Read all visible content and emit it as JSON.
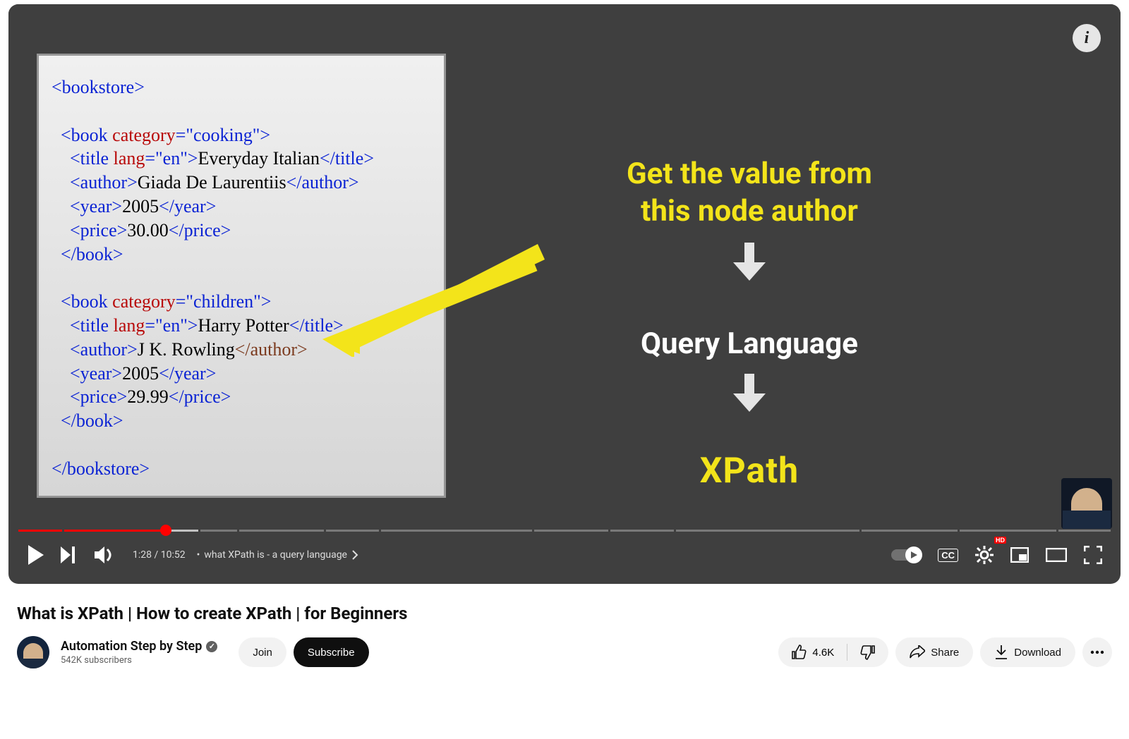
{
  "video": {
    "title": "What is XPath | How to create XPath | for Beginners",
    "current_time": "1:28",
    "duration": "10:52",
    "chapter_label": "what XPath is - a query language",
    "separator": " / ",
    "chapter_prefix": " • ",
    "progress_percent": 13.5,
    "buffered_percent": 16.5,
    "chapter_marks_percent": [
      4,
      16.5,
      20,
      28,
      33,
      47,
      54,
      60,
      77,
      86,
      95
    ]
  },
  "slide": {
    "code_lines": [
      [
        {
          "cls": "t-blue",
          "t": "<bookstore>"
        }
      ],
      [
        {
          "cls": "",
          "t": ""
        }
      ],
      [
        {
          "cls": "",
          "t": "  "
        },
        {
          "cls": "t-blue",
          "t": "<book "
        },
        {
          "cls": "t-red",
          "t": "category"
        },
        {
          "cls": "t-blue",
          "t": "="
        },
        {
          "cls": "t-blue",
          "t": "\"cooking\">"
        }
      ],
      [
        {
          "cls": "",
          "t": "    "
        },
        {
          "cls": "t-blue",
          "t": "<title "
        },
        {
          "cls": "t-red",
          "t": "lang"
        },
        {
          "cls": "t-blue",
          "t": "=\"en\">"
        },
        {
          "cls": "t-black",
          "t": "Everyday Italian"
        },
        {
          "cls": "t-blue",
          "t": "</title>"
        }
      ],
      [
        {
          "cls": "",
          "t": "    "
        },
        {
          "cls": "t-blue",
          "t": "<author>"
        },
        {
          "cls": "t-black",
          "t": "Giada De Laurentiis"
        },
        {
          "cls": "t-blue",
          "t": "</author>"
        }
      ],
      [
        {
          "cls": "",
          "t": "    "
        },
        {
          "cls": "t-blue",
          "t": "<year>"
        },
        {
          "cls": "t-black",
          "t": "2005"
        },
        {
          "cls": "t-blue",
          "t": "</year>"
        }
      ],
      [
        {
          "cls": "",
          "t": "    "
        },
        {
          "cls": "t-blue",
          "t": "<price>"
        },
        {
          "cls": "t-black",
          "t": "30.00"
        },
        {
          "cls": "t-blue",
          "t": "</price>"
        }
      ],
      [
        {
          "cls": "",
          "t": "  "
        },
        {
          "cls": "t-blue",
          "t": "</book>"
        }
      ],
      [
        {
          "cls": "",
          "t": ""
        }
      ],
      [
        {
          "cls": "",
          "t": "  "
        },
        {
          "cls": "t-blue",
          "t": "<book "
        },
        {
          "cls": "t-red",
          "t": "category"
        },
        {
          "cls": "t-blue",
          "t": "=\"children\">"
        }
      ],
      [
        {
          "cls": "",
          "t": "    "
        },
        {
          "cls": "t-blue",
          "t": "<title "
        },
        {
          "cls": "t-red",
          "t": "lang"
        },
        {
          "cls": "t-blue",
          "t": "=\"en\">"
        },
        {
          "cls": "t-black",
          "t": "Harry Potter"
        },
        {
          "cls": "t-blue",
          "t": "</title>"
        }
      ],
      [
        {
          "cls": "",
          "t": "    "
        },
        {
          "cls": "t-blue",
          "t": "<author>"
        },
        {
          "cls": "t-black",
          "t": "J K. Rowling"
        },
        {
          "cls": "t-brown",
          "t": "</author>"
        }
      ],
      [
        {
          "cls": "",
          "t": "    "
        },
        {
          "cls": "t-blue",
          "t": "<year>"
        },
        {
          "cls": "t-black",
          "t": "2005"
        },
        {
          "cls": "t-blue",
          "t": "</year>"
        }
      ],
      [
        {
          "cls": "",
          "t": "    "
        },
        {
          "cls": "t-blue",
          "t": "<price>"
        },
        {
          "cls": "t-black",
          "t": "29.99"
        },
        {
          "cls": "t-blue",
          "t": "</price>"
        }
      ],
      [
        {
          "cls": "",
          "t": "  "
        },
        {
          "cls": "t-blue",
          "t": "</book>"
        }
      ],
      [
        {
          "cls": "",
          "t": ""
        }
      ],
      [
        {
          "cls": "t-blue",
          "t": "</bookstore>"
        }
      ]
    ],
    "annotation_line1": "Get the value from",
    "annotation_line2": "this node author",
    "annotation_mid": "Query Language",
    "annotation_end": "XPath"
  },
  "channel": {
    "name": "Automation Step by Step",
    "subscribers": "542K subscribers"
  },
  "actions": {
    "join": "Join",
    "subscribe": "Subscribe",
    "likes": "4.6K",
    "share": "Share",
    "download": "Download"
  },
  "info_icon": "i",
  "cc_label": "CC",
  "hd_label": "HD"
}
